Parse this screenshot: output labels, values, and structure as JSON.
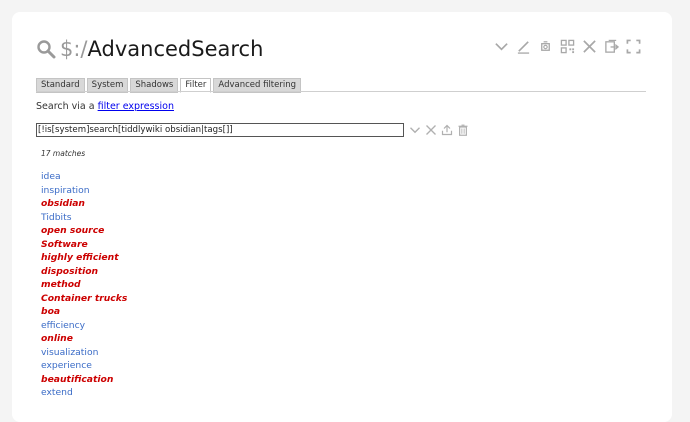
{
  "tiddler": {
    "title_prefix": "$:/",
    "title_main": "AdvancedSearch"
  },
  "toolbar": {
    "icons": [
      "chevron-down-icon",
      "edit-icon",
      "permalink-icon",
      "qr-icon",
      "close-icon",
      "export-icon",
      "fullscreen-icon"
    ]
  },
  "tabs": [
    {
      "label": "Standard",
      "active": false
    },
    {
      "label": "System",
      "active": false
    },
    {
      "label": "Shadows",
      "active": false
    },
    {
      "label": "Filter",
      "active": true
    },
    {
      "label": "Advanced filtering",
      "active": false
    }
  ],
  "hint": {
    "text": "Search via a ",
    "link": "filter expression"
  },
  "search": {
    "value": "[!is[system]search[tiddlywiki obsidian|tags[]]"
  },
  "match_count": "17 matches",
  "colors": {
    "existing_link": "#3b6cc7",
    "missing_link": "#cc0000"
  },
  "results": [
    {
      "label": "idea",
      "missing": false
    },
    {
      "label": "inspiration",
      "missing": false
    },
    {
      "label": "obsidian",
      "missing": true
    },
    {
      "label": "Tidbits",
      "missing": false
    },
    {
      "label": "open source",
      "missing": true
    },
    {
      "label": "Software",
      "missing": true
    },
    {
      "label": "highly efficient",
      "missing": true
    },
    {
      "label": "disposition",
      "missing": true
    },
    {
      "label": "method",
      "missing": true
    },
    {
      "label": "Container trucks",
      "missing": true
    },
    {
      "label": "boa",
      "missing": true
    },
    {
      "label": "efficiency",
      "missing": false
    },
    {
      "label": "online",
      "missing": true
    },
    {
      "label": "visualization",
      "missing": false
    },
    {
      "label": "experience",
      "missing": false
    },
    {
      "label": "beautification",
      "missing": true
    },
    {
      "label": "extend",
      "missing": false
    }
  ]
}
